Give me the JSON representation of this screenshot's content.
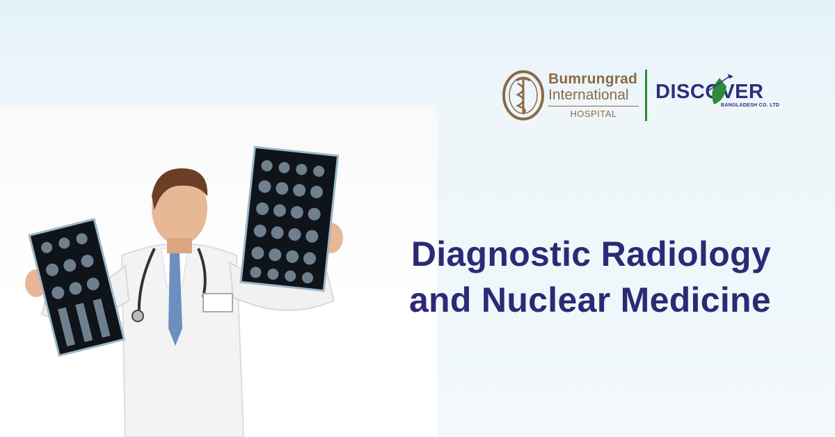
{
  "logos": {
    "hospital": {
      "line1": "Bumrungrad",
      "line2": "International",
      "line3": "HOSPITAL"
    },
    "partner": {
      "name": "DISCOVER",
      "subtitle": "BANGLADESH CO. LTD"
    }
  },
  "headline": {
    "line1": "Diagnostic Radiology",
    "line2": "and Nuclear Medicine"
  },
  "colors": {
    "headline": "#2c2a75",
    "hospital_brand": "#8b6a43",
    "partner_brand": "#2c2f7a",
    "partner_accent": "#2f8a3a",
    "background": "#eef6fa"
  },
  "icons": {
    "hospital_seal": "caduceus-seal-icon",
    "partner_leaf": "leaf-plane-icon"
  }
}
